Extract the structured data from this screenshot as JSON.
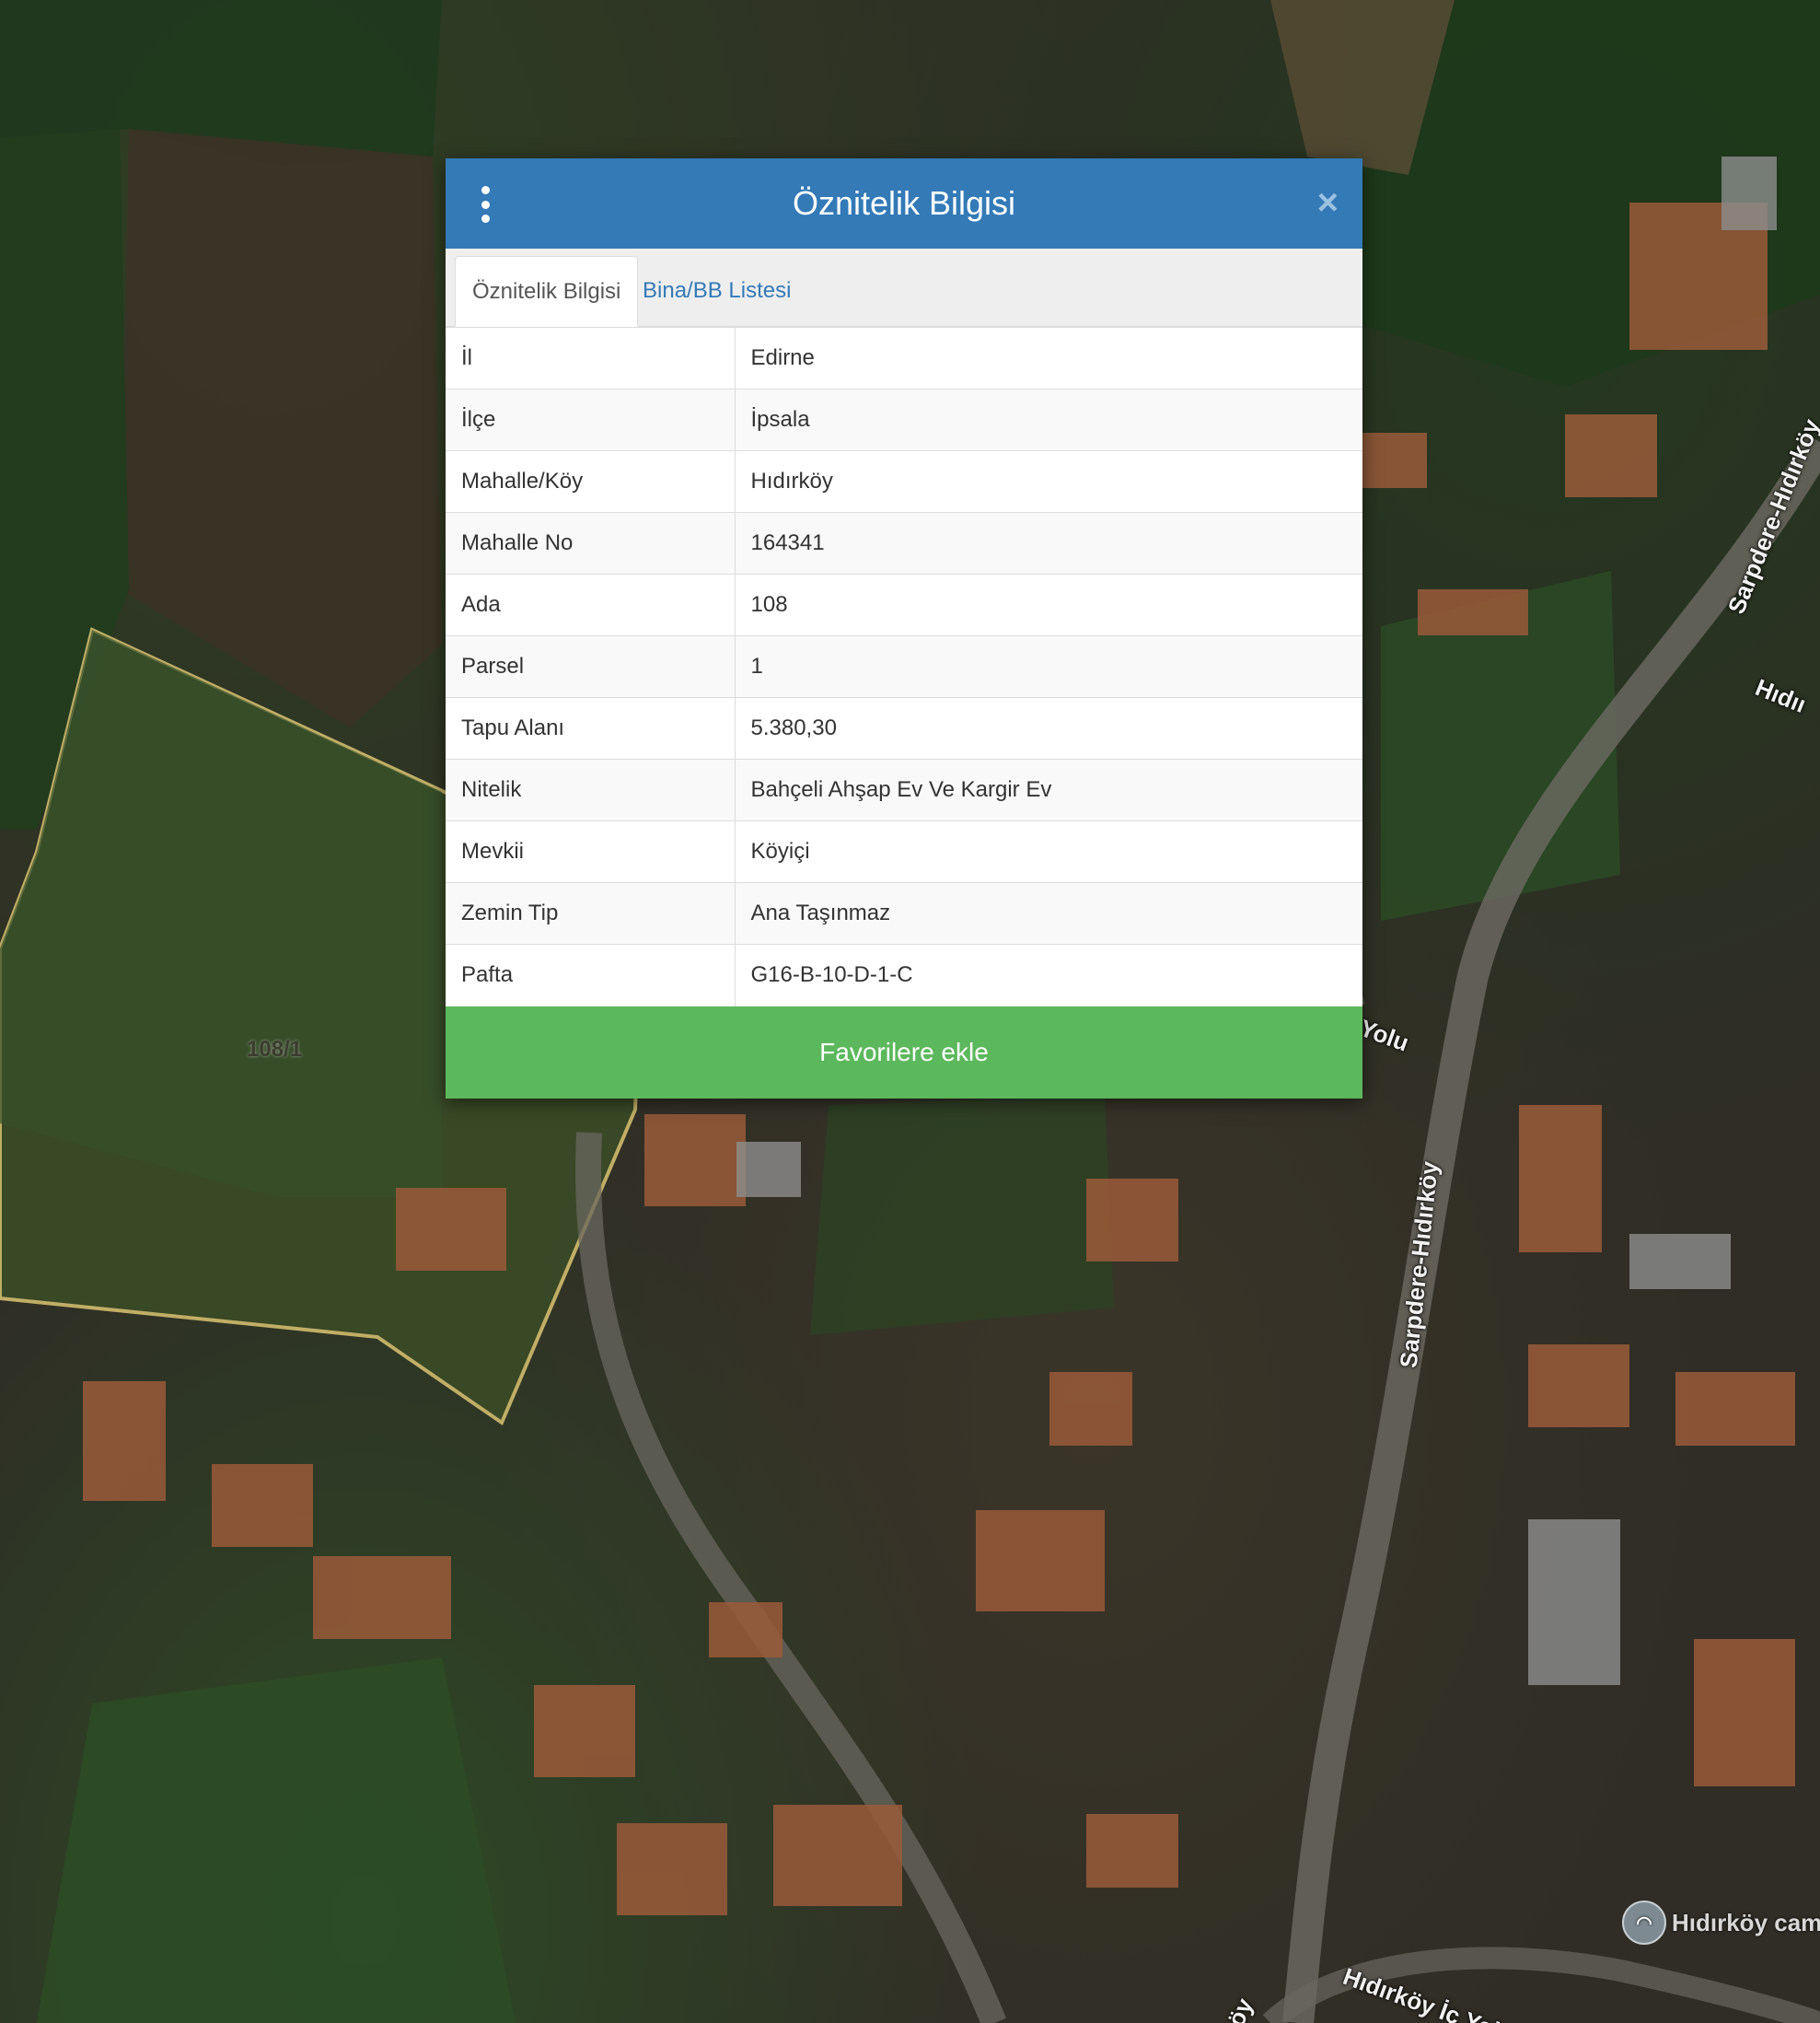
{
  "map": {
    "parcel_label": "108/1",
    "road_labels": [
      "Sarpdere-Hıdırköy",
      "Hıdıı",
      "Yolu",
      "Sarpdere-Hıdırköy",
      "Hıdırköy İç Yolu",
      "köy"
    ],
    "poi_label": "Hıdırköy cam"
  },
  "dialog": {
    "title": "Öznitelik Bilgisi",
    "menu_icon": "vertical-ellipsis-icon",
    "close_label": "×",
    "tabs": [
      {
        "label": "Öznitelik Bilgisi",
        "active": true
      },
      {
        "label": "Bina/BB Listesi",
        "active": false
      }
    ],
    "rows": [
      {
        "key": "İl",
        "value": "Edirne"
      },
      {
        "key": "İlçe",
        "value": "İpsala"
      },
      {
        "key": "Mahalle/Köy",
        "value": "Hıdırköy"
      },
      {
        "key": "Mahalle No",
        "value": "164341"
      },
      {
        "key": "Ada",
        "value": "108"
      },
      {
        "key": "Parsel",
        "value": "1"
      },
      {
        "key": "Tapu Alanı",
        "value": "5.380,30"
      },
      {
        "key": "Nitelik",
        "value": "Bahçeli Ahşap Ev Ve Kargir Ev"
      },
      {
        "key": "Mevkii",
        "value": "Köyiçi"
      },
      {
        "key": "Zemin Tip",
        "value": "Ana Taşınmaz"
      },
      {
        "key": "Pafta",
        "value": "G16-B-10-D-1-C"
      }
    ],
    "favorite_button": "Favorilere ekle"
  },
  "colors": {
    "header": "#337ab7",
    "favorite_button": "#5cb85c",
    "parcel_outline": "#c9b56a"
  }
}
